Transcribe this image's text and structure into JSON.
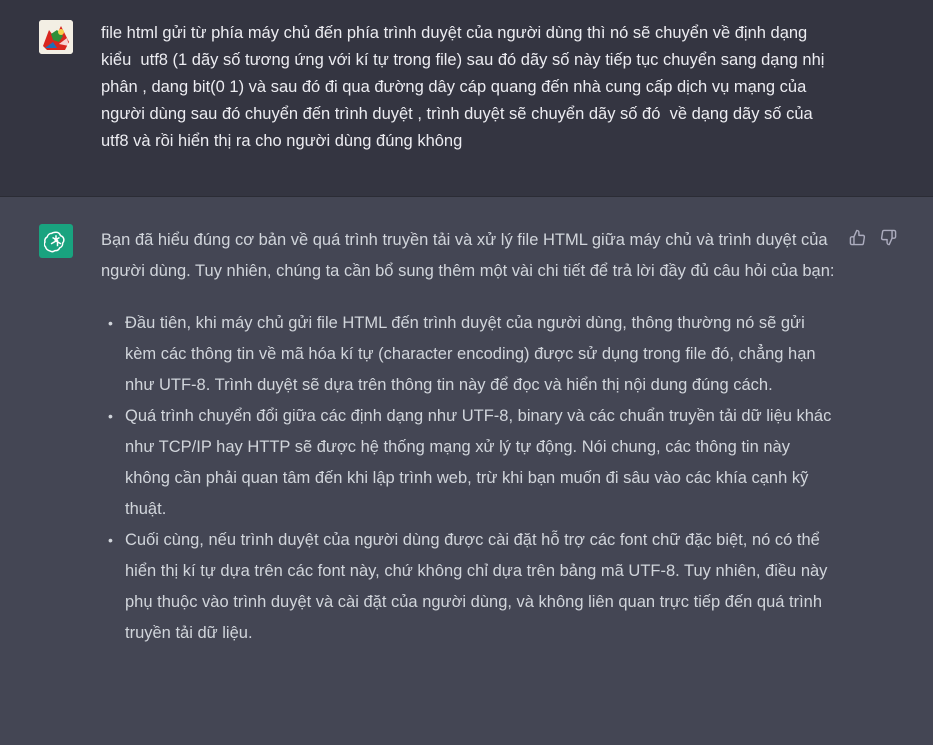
{
  "user_message": {
    "avatar": "user-avatar-image",
    "text": "file html gửi từ phía máy chủ đến phía trình duyệt của người dùng thì nó sẽ chuyển về định dạng kiểu  utf8 (1 dãy số tương ứng với kí tự trong file) sau đó dãy số này tiếp tục chuyển sang dạng nhị phân , dang bit(0 1) và sau đó đi qua đường dây cáp quang đến nhà cung cấp dịch vụ mạng của người dùng sau đó chuyển đến trình duyệt , trình duyệt sẽ chuyển dãy số đó  về dạng dãy số của utf8 và rồi hiển thị ra cho người dùng đúng không"
  },
  "assistant_message": {
    "avatar": "openai-logo-icon",
    "intro": "Bạn đã hiểu đúng cơ bản về quá trình truyền tải và xử lý file HTML giữa máy chủ và trình duyệt của người dùng. Tuy nhiên, chúng ta cần bổ sung thêm một vài chi tiết để trả lời đầy đủ câu hỏi của bạn:",
    "bullets": [
      "Đầu tiên, khi máy chủ gửi file HTML đến trình duyệt của người dùng, thông thường nó sẽ gửi kèm các thông tin về mã hóa kí tự (character encoding) được sử dụng trong file đó, chẳng hạn như UTF-8. Trình duyệt sẽ dựa trên thông tin này để đọc và hiển thị nội dung đúng cách.",
      "Quá trình chuyển đổi giữa các định dạng như UTF-8, binary và các chuẩn truyền tải dữ liệu khác như TCP/IP hay HTTP sẽ được hệ thống mạng xử lý tự động. Nói chung, các thông tin này không cần phải quan tâm đến khi lập trình web, trừ khi bạn muốn đi sâu vào các khía cạnh kỹ thuật.",
      "Cuối cùng, nếu trình duyệt của người dùng được cài đặt hỗ trợ các font chữ đặc biệt, nó có thể hiển thị kí tự dựa trên các font này, chứ không chỉ dựa trên bảng mã UTF-8. Tuy nhiên, điều này phụ thuộc vào trình duyệt và cài đặt của người dùng, và không liên quan trực tiếp đến quá trình truyền tải dữ liệu."
    ],
    "feedback": [
      "thumbs-up-icon",
      "thumbs-down-icon"
    ]
  },
  "colors": {
    "user_bg": "#343541",
    "assistant_bg": "#444654",
    "bot_avatar": "#19a37f",
    "text_user": "#ececf1",
    "text_bot": "#d1d5db"
  }
}
